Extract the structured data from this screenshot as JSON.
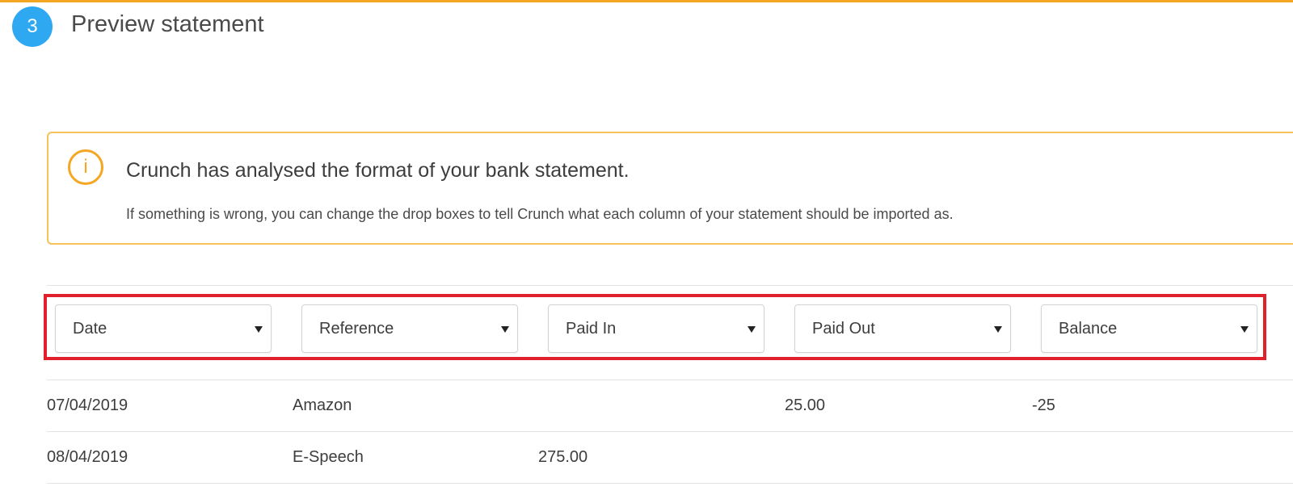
{
  "step": {
    "number": "3",
    "title": "Preview statement"
  },
  "notice": {
    "title": "Crunch has analysed the format of your bank statement.",
    "body": "If something is wrong, you can change the drop boxes to tell Crunch what each column of your statement should be imported as."
  },
  "columns": [
    {
      "label": "Date"
    },
    {
      "label": "Reference"
    },
    {
      "label": "Paid In"
    },
    {
      "label": "Paid Out"
    },
    {
      "label": "Balance"
    }
  ],
  "rows": [
    {
      "date": "07/04/2019",
      "reference": "Amazon",
      "paid_in": "",
      "paid_out": "25.00",
      "balance": "-25"
    },
    {
      "date": "08/04/2019",
      "reference": "E-Speech",
      "paid_in": "275.00",
      "paid_out": "",
      "balance": ""
    }
  ],
  "colors": {
    "accent": "#f5a623",
    "step": "#2fa8f2",
    "highlight": "#e0202a"
  }
}
